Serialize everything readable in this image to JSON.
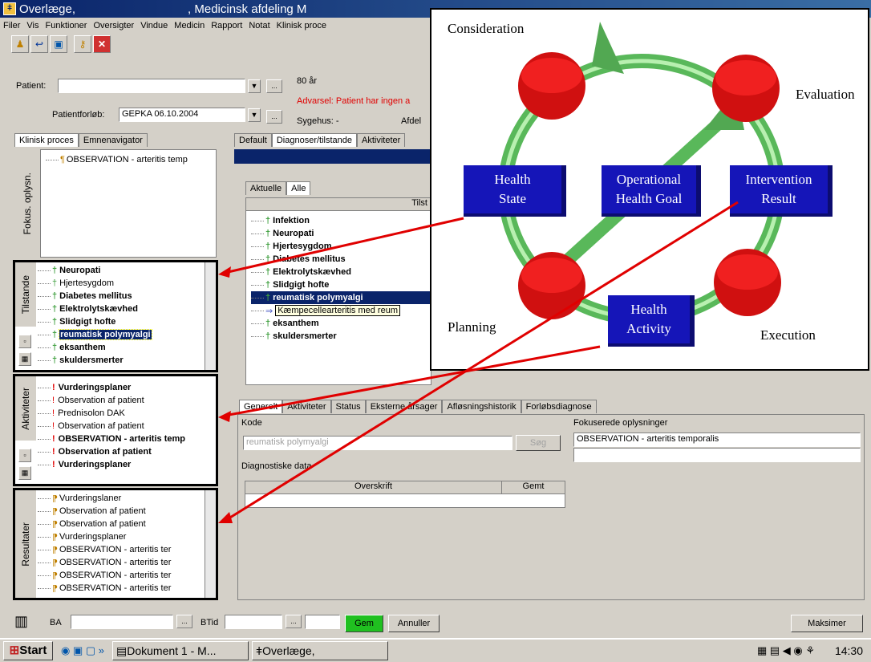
{
  "window": {
    "title_a": "Overlæge,",
    "title_b": ", Medicinsk afdeling M"
  },
  "menu": [
    "Filer",
    "Vis",
    "Funktioner",
    "Oversigter",
    "Vindue",
    "Medicin",
    "Rapport",
    "Notat",
    "Klinisk proce"
  ],
  "patient": {
    "label": "Patient:",
    "age": "80 år",
    "warning": "Advarsel: Patient har ingen a",
    "course_label": "Patientforløb:",
    "course_value": "GEPKA 06.10.2004",
    "hospital": "Sygehus: -",
    "department": "Afdel"
  },
  "left_tabs": [
    "Klinisk proces",
    "Emnenavigator"
  ],
  "fokus": {
    "label": "Fokus. oplysn.",
    "items": [
      "OBSERVATION - arteritis temp"
    ]
  },
  "tilstande": {
    "label": "Tilstande",
    "items": [
      "Neuropati",
      "Hjertesygdom",
      "Diabetes mellitus",
      "Elektrolytskævhed",
      "Slidgigt hofte",
      "reumatisk polymyalgi",
      "eksanthem",
      "skuldersmerter"
    ]
  },
  "aktiviteter": {
    "label": "Aktiviteter",
    "items": [
      "Vurderingsplaner",
      "Observation af patient",
      "Prednisolon DAK",
      "Observation af patient",
      "OBSERVATION - arteritis temp",
      "Observation af patient",
      "Vurderingsplaner"
    ]
  },
  "resultater": {
    "label": "Resultater",
    "items": [
      "Vurderingslaner",
      "Observation af patient",
      "Observation af patient",
      "Vurderingsplaner",
      "OBSERVATION - arteritis ter",
      "OBSERVATION - arteritis ter",
      "OBSERVATION - arteritis ter",
      "OBSERVATION - arteritis ter"
    ]
  },
  "main_tabs": [
    "Default",
    "Diagnoser/tilstande",
    "Aktiviteter"
  ],
  "sub_tabs": [
    "Aktuelle",
    "Alle"
  ],
  "diag_header": "Tilst",
  "diag_items": [
    "Infektion",
    "Neuropati",
    "Hjertesygdom",
    "Diabetes mellitus",
    "Elektrolytskævhed",
    "Slidgigt hofte",
    "reumatisk polymyalgi",
    "Kæmpecellearteritis med reum",
    "eksanthem",
    "skuldersmerter"
  ],
  "detail_tabs": [
    "Generelt",
    "Aktiviteter",
    "Status",
    "Eksterne årsager",
    "Afløsningshistorik",
    "Forløbsdiagnose"
  ],
  "detail": {
    "kode_label": "Kode",
    "kode_value": "reumatisk polymyalgi",
    "search_btn": "Søg",
    "diag_label": "Diagnostiske data",
    "col_overskrift": "Overskrift",
    "col_gemt": "Gemt",
    "fokus_label": "Fokuserede oplysninger",
    "fokus_value": "OBSERVATION - arteritis temporalis"
  },
  "bottom": {
    "ba": "BA",
    "btid": "BTid",
    "save": "Gem",
    "cancel": "Annuller",
    "maximize": "Maksimer"
  },
  "taskbar": {
    "start": "Start",
    "task1": "Dokument 1 - M...",
    "task2": "Overlæge,",
    "clock": "14:30"
  },
  "diagram": {
    "consideration": "Consideration",
    "evaluation": "Evaluation",
    "planning": "Planning",
    "execution": "Execution",
    "box1_a": "Health",
    "box1_b": "State",
    "box2_a": "Operational",
    "box2_b": "Health Goal",
    "box3_a": "Intervention",
    "box3_b": "Result",
    "box4_a": "Health",
    "box4_b": "Activity"
  }
}
